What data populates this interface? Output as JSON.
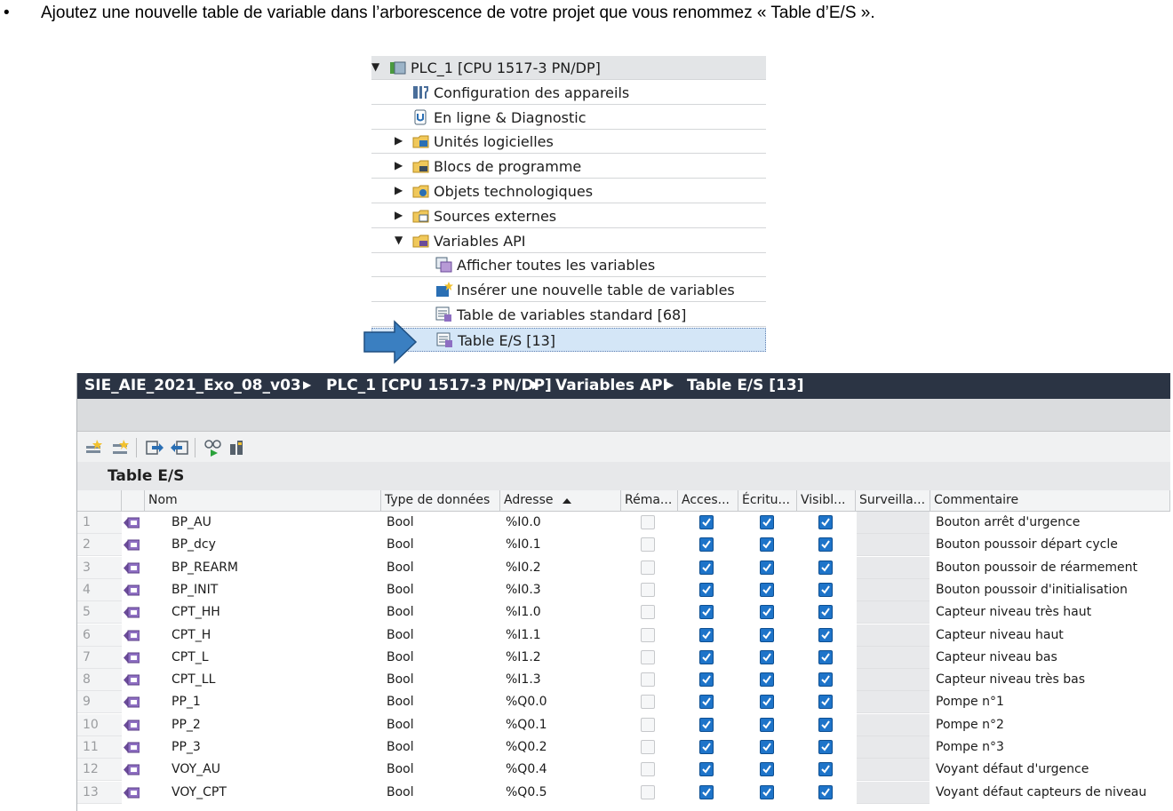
{
  "instruction": {
    "bullet": "•",
    "text": "Ajoutez une nouvelle table de variable dans l’arborescence de votre projet que vous renommez « Table d’E/S »."
  },
  "tree": {
    "items": [
      {
        "label": "PLC_1 [CPU 1517-3 PN/DP]",
        "icon": "plc-icon",
        "expander": "expanded"
      },
      {
        "label": "Configuration des appareils",
        "icon": "device-config-icon",
        "expander": "none"
      },
      {
        "label": "En ligne & Diagnostic",
        "icon": "online-diagnostic-icon",
        "expander": "none"
      },
      {
        "label": "Unités logicielles",
        "icon": "software-units-folder-icon",
        "expander": "collapsed"
      },
      {
        "label": "Blocs de programme",
        "icon": "program-blocks-folder-icon",
        "expander": "collapsed"
      },
      {
        "label": "Objets technologiques",
        "icon": "technology-objects-folder-icon",
        "expander": "collapsed"
      },
      {
        "label": "Sources externes",
        "icon": "external-sources-folder-icon",
        "expander": "collapsed"
      },
      {
        "label": "Variables API",
        "icon": "plc-tags-folder-icon",
        "expander": "expanded"
      },
      {
        "label": "Afficher toutes les variables",
        "icon": "show-all-tags-icon",
        "expander": "none"
      },
      {
        "label": "Insérer une nouvelle table de variables",
        "icon": "add-tag-table-icon",
        "expander": "none"
      },
      {
        "label": "Table de variables standard [68]",
        "icon": "tag-table-icon",
        "expander": "none"
      },
      {
        "label": "Table E/S [13]",
        "icon": "tag-table-icon",
        "expander": "none",
        "selected": true
      }
    ]
  },
  "editor": {
    "breadcrumb": [
      "SIE_AIE_2021_Exo_08_v03",
      "PLC_1 [CPU 1517-3 PN/DP]",
      "Variables API",
      "Table E/S [13]"
    ],
    "table_title": "Table E/S",
    "toolbar_icons": [
      "add-row-icon",
      "insert-row-icon",
      "export-icon",
      "import-icon",
      "monitor-icon",
      "keep-actual-values-icon"
    ],
    "columns": [
      "Nom",
      "Type de données",
      "Adresse",
      "Réma...",
      "Acces...",
      "Écritu...",
      "Visibl...",
      "Surveilla...",
      "Commentaire"
    ],
    "sort_column": "Adresse",
    "rows": [
      {
        "n": "1",
        "name": "BP_AU",
        "type": "Bool",
        "addr": "%I0.0",
        "comment": "Bouton arrêt d'urgence"
      },
      {
        "n": "2",
        "name": "BP_dcy",
        "type": "Bool",
        "addr": "%I0.1",
        "comment": "Bouton poussoir départ cycle"
      },
      {
        "n": "3",
        "name": "BP_REARM",
        "type": "Bool",
        "addr": "%I0.2",
        "comment": "Bouton poussoir de réarmement"
      },
      {
        "n": "4",
        "name": "BP_INIT",
        "type": "Bool",
        "addr": "%I0.3",
        "comment": "Bouton poussoir d'initialisation"
      },
      {
        "n": "5",
        "name": "CPT_HH",
        "type": "Bool",
        "addr": "%I1.0",
        "comment": "Capteur niveau très haut"
      },
      {
        "n": "6",
        "name": "CPT_H",
        "type": "Bool",
        "addr": "%I1.1",
        "comment": "Capteur niveau haut"
      },
      {
        "n": "7",
        "name": "CPT_L",
        "type": "Bool",
        "addr": "%I1.2",
        "comment": "Capteur niveau bas"
      },
      {
        "n": "8",
        "name": "CPT_LL",
        "type": "Bool",
        "addr": "%I1.3",
        "comment": "Capteur niveau très bas"
      },
      {
        "n": "9",
        "name": "PP_1",
        "type": "Bool",
        "addr": "%Q0.0",
        "comment": "Pompe n°1"
      },
      {
        "n": "10",
        "name": "PP_2",
        "type": "Bool",
        "addr": "%Q0.1",
        "comment": "Pompe n°2"
      },
      {
        "n": "11",
        "name": "PP_3",
        "type": "Bool",
        "addr": "%Q0.2",
        "comment": "Pompe n°3"
      },
      {
        "n": "12",
        "name": "VOY_AU",
        "type": "Bool",
        "addr": "%Q0.4",
        "comment": "Voyant défaut d'urgence"
      },
      {
        "n": "13",
        "name": "VOY_CPT",
        "type": "Bool",
        "addr": "%Q0.5",
        "comment": "Voyant défaut capteurs de niveau"
      }
    ],
    "row_flags": {
      "retain": false,
      "accessible": true,
      "writable": true,
      "visible": true
    }
  },
  "colors": {
    "title_bar": "#2b3444",
    "selection": "#d4e6f7",
    "arrow": "#3a7fc1",
    "checkbox": "#1e74c9"
  }
}
